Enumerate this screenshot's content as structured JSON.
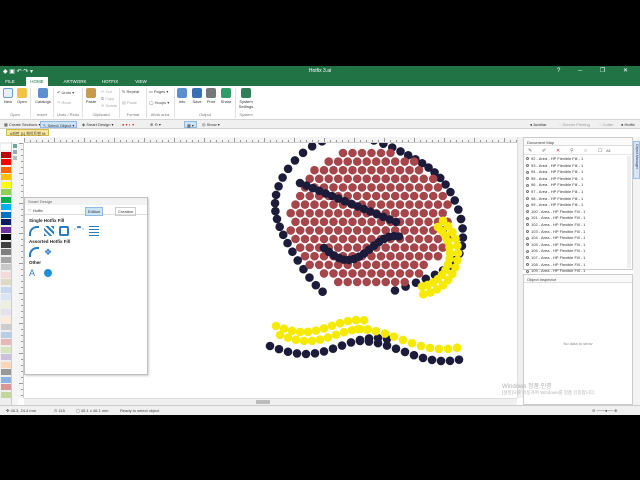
{
  "window": {
    "title": "Hotfix 3.ai"
  },
  "tabs": [
    "FILE",
    "HOME",
    "ARTWORK",
    "HOTFIX",
    "VIEW"
  ],
  "active_tab": "HOME",
  "ribbon": {
    "new": "New",
    "open": "Open",
    "catalogs": "Catalogs",
    "undo": "Undo",
    "redo": "Redo",
    "cut": "Cut",
    "copy": "Copy",
    "paste": "Paste",
    "delete": "Delete",
    "repeat": "Repeat",
    "paste2": "Paste",
    "pages": "Pages",
    "hoops": "Hoops",
    "info": "Info",
    "save": "Save",
    "print": "Print",
    "share": "Share",
    "system_settings": "System Settings",
    "groups": {
      "open": "Open",
      "insert": "Insert",
      "undo_redo": "Undo / Redo",
      "clipboard": "Clipboard",
      "format": "Format",
      "work_area": "Work area",
      "output": "Output",
      "system": "System"
    }
  },
  "toolbar": {
    "create_sections": "Create Sections",
    "select_object": "Select Object",
    "smart_design": "Smart Design",
    "show": "Show",
    "right_items": [
      "Auxiliar",
      "Screen Printing",
      "Cutter",
      "Hotfix"
    ]
  },
  "document_tab": "#좌판 [1] 화이트팬 M",
  "smart_design": {
    "title": "Smart Design",
    "hotfix": "Hotfix",
    "edition": "Edition",
    "creation": "Creation",
    "single_fill": "Single Hotfix Fill",
    "assorted_fill": "Assorted Hotfix Fill",
    "other": "Other"
  },
  "document_map": {
    "title": "Document Map",
    "all": "All",
    "items": [
      "92 - Area - HP Flexible Fill - 1",
      "93 - Area - HP Flexible Fill - 1",
      "94 - Area - HP Flexible Fill - 1",
      "95 - Area - HP Flexible Fill - 1",
      "96 - Area - HP Flexible Fill - 1",
      "97 - Area - HP Flexible Fill - 1",
      "98 - Area - HP Flexible Fill - 1",
      "99 - Area - HP Flexible Fill - 1",
      "100 - Area - HP Flexible Fill - 1",
      "101 - Area - HP Flexible Fill - 1",
      "102 - Area - HP Flexible Fill - 1",
      "103 - Area - HP Flexible Fill - 1",
      "104 - Area - HP Flexible Fill - 1",
      "105 - Area - HP Flexible Fill - 1",
      "106 - Area - HP Flexible Fill - 1",
      "107 - Area - HP Flexible Fill - 1",
      "108 - Area - HP Flexible Fill - 1",
      "109 - Area - HP Flexible Fill - 1",
      "110 - Area - HP Flexible Fill - 1"
    ]
  },
  "object_inspector": {
    "title": "Object Inspector",
    "empty": "No data to show"
  },
  "side_tab": "Object Manager",
  "status": {
    "coords": "48.3, 24.4 mm",
    "zoom": "115",
    "size": "45.1 x 46.1 mm",
    "message": "Ready to select object"
  },
  "watermark": {
    "line1": "Windows 정품 인증",
    "line2": "[설정]으로 이동하여 Windows를 정품 인증합니다."
  },
  "colors": {
    "brand": "#217346",
    "dark": "#1c1b3a",
    "maroon": "#a6464b",
    "yellow": "#f5ea00"
  }
}
